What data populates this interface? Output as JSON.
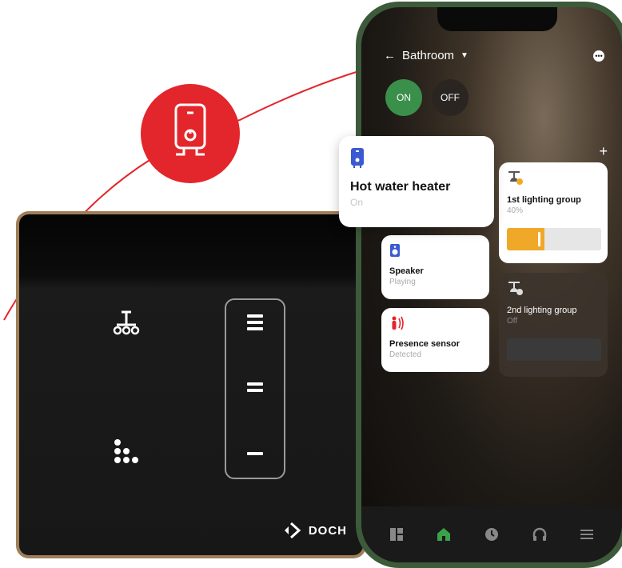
{
  "header": {
    "room": "Bathroom"
  },
  "power": {
    "on_label": "ON",
    "off_label": "OFF"
  },
  "devices": {
    "water_heater": {
      "name": "Hot water heater",
      "status": "On",
      "icon": "water-heater-icon"
    },
    "speaker": {
      "name": "Speaker",
      "status": "Playing",
      "icon": "speaker-icon"
    },
    "presence": {
      "name": "Presence sensor",
      "status": "Detected",
      "icon": "presence-icon"
    },
    "light1": {
      "name": "1st lighting group",
      "status": "40%",
      "level_percent": 40,
      "icon": "ceiling-light-icon"
    },
    "light2": {
      "name": "2nd lighting group",
      "status": "Off",
      "level_percent": 0,
      "icon": "ceiling-light-icon"
    }
  },
  "tabs": [
    "dashboard-icon",
    "home-icon",
    "clock-icon",
    "headphones-icon",
    "menu-icon"
  ],
  "panel": {
    "brand": "DOCH"
  },
  "colors": {
    "accent_red": "#e3262b",
    "on_green": "#3a8f4a",
    "level_orange": "#f0a829",
    "active_tab": "#3aa34a"
  }
}
